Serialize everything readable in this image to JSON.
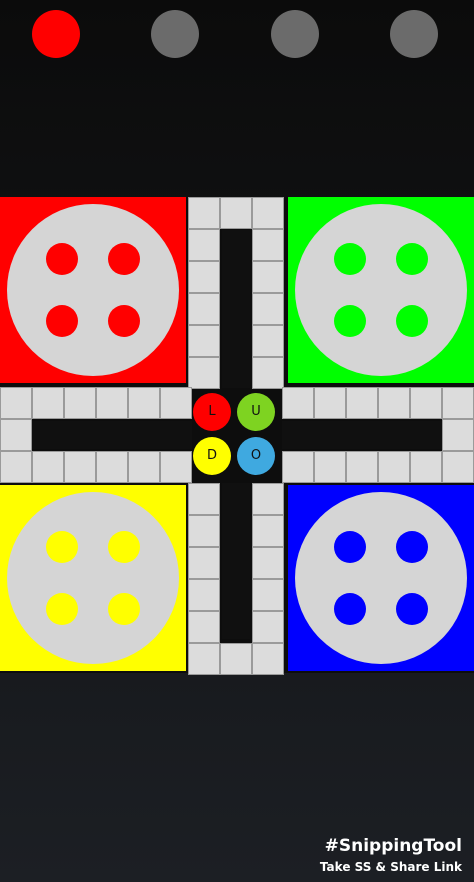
{
  "players": [
    {
      "color": "#ff0000",
      "active": true
    },
    {
      "color": "#6b6b6b",
      "active": false
    },
    {
      "color": "#6b6b6b",
      "active": false
    },
    {
      "color": "#6b6b6b",
      "active": false
    }
  ],
  "homes": {
    "red": {
      "color": "#ff0000",
      "token_color": "#ff0000"
    },
    "green": {
      "color": "#00ff00",
      "token_color": "#00ff00"
    },
    "yellow": {
      "color": "#ffff00",
      "token_color": "#ffff00"
    },
    "blue": {
      "color": "#0000ff",
      "token_color": "#0000ff"
    }
  },
  "center": {
    "letters": [
      "L",
      "U",
      "D",
      "O"
    ],
    "colors": [
      "#ff0000",
      "#7ed321",
      "#ffff00",
      "#3fa9e0"
    ]
  },
  "watermark": {
    "line1": "#SnippingTool",
    "line2": "Take SS & Share Link"
  }
}
